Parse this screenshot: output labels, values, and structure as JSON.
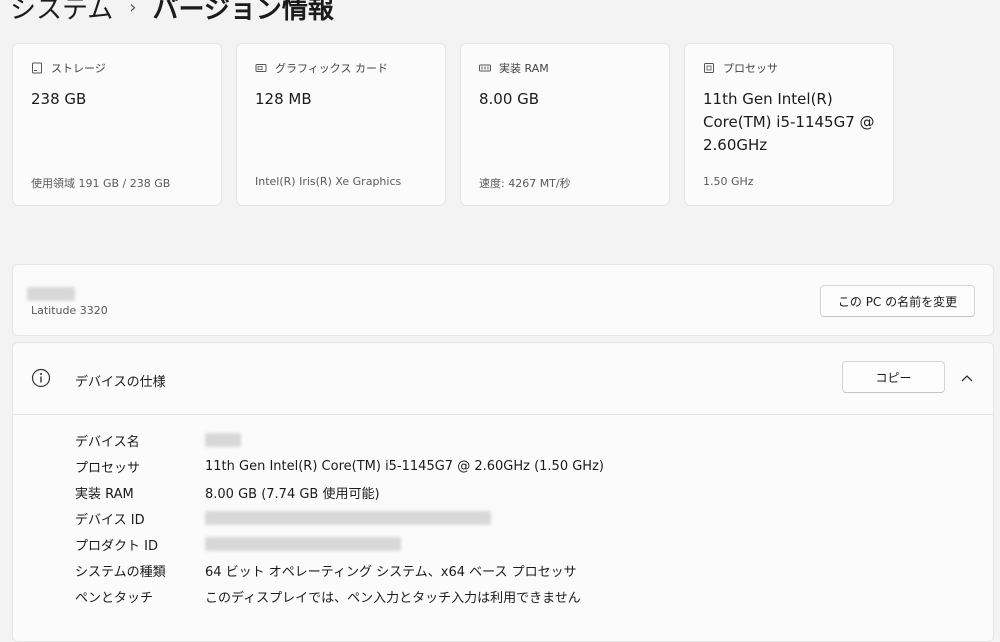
{
  "breadcrumb": {
    "parent": "システム",
    "separator": "›",
    "current": "バージョン情報"
  },
  "cards": [
    {
      "icon": "storage-icon",
      "title": "ストレージ",
      "value": "238 GB",
      "sub": "使用領域 191 GB / 238 GB"
    },
    {
      "icon": "graphics-card-icon",
      "title": "グラフィックス カード",
      "value": "128 MB",
      "sub": "Intel(R) Iris(R) Xe Graphics"
    },
    {
      "icon": "ram-icon",
      "title": "実装 RAM",
      "value": "8.00 GB",
      "sub": "速度: 4267 MT/秒"
    },
    {
      "icon": "processor-icon",
      "title": "プロセッサ",
      "value": "11th Gen Intel(R) Core(TM) i5-1145G7 @ 2.60GHz",
      "sub": "1.50 GHz"
    }
  ],
  "device_name_panel": {
    "model": "Latitude 3320",
    "rename_label": "この PC の名前を変更"
  },
  "spec": {
    "title": "デバイスの仕様",
    "copy_label": "コピー",
    "rows": [
      {
        "key": "デバイス名",
        "value": ""
      },
      {
        "key": "プロセッサ",
        "value": "11th Gen Intel(R) Core(TM) i5-1145G7 @ 2.60GHz (1.50 GHz)"
      },
      {
        "key": "実装 RAM",
        "value": "8.00 GB (7.74 GB 使用可能)"
      },
      {
        "key": "デバイス ID",
        "value": ""
      },
      {
        "key": "プロダクト ID",
        "value": ""
      },
      {
        "key": "システムの種類",
        "value": "64 ビット オペレーティング システム、x64 ベース プロセッサ"
      },
      {
        "key": "ペンとタッチ",
        "value": "このディスプレイでは、ペン入力とタッチ入力は利用できません"
      }
    ]
  }
}
